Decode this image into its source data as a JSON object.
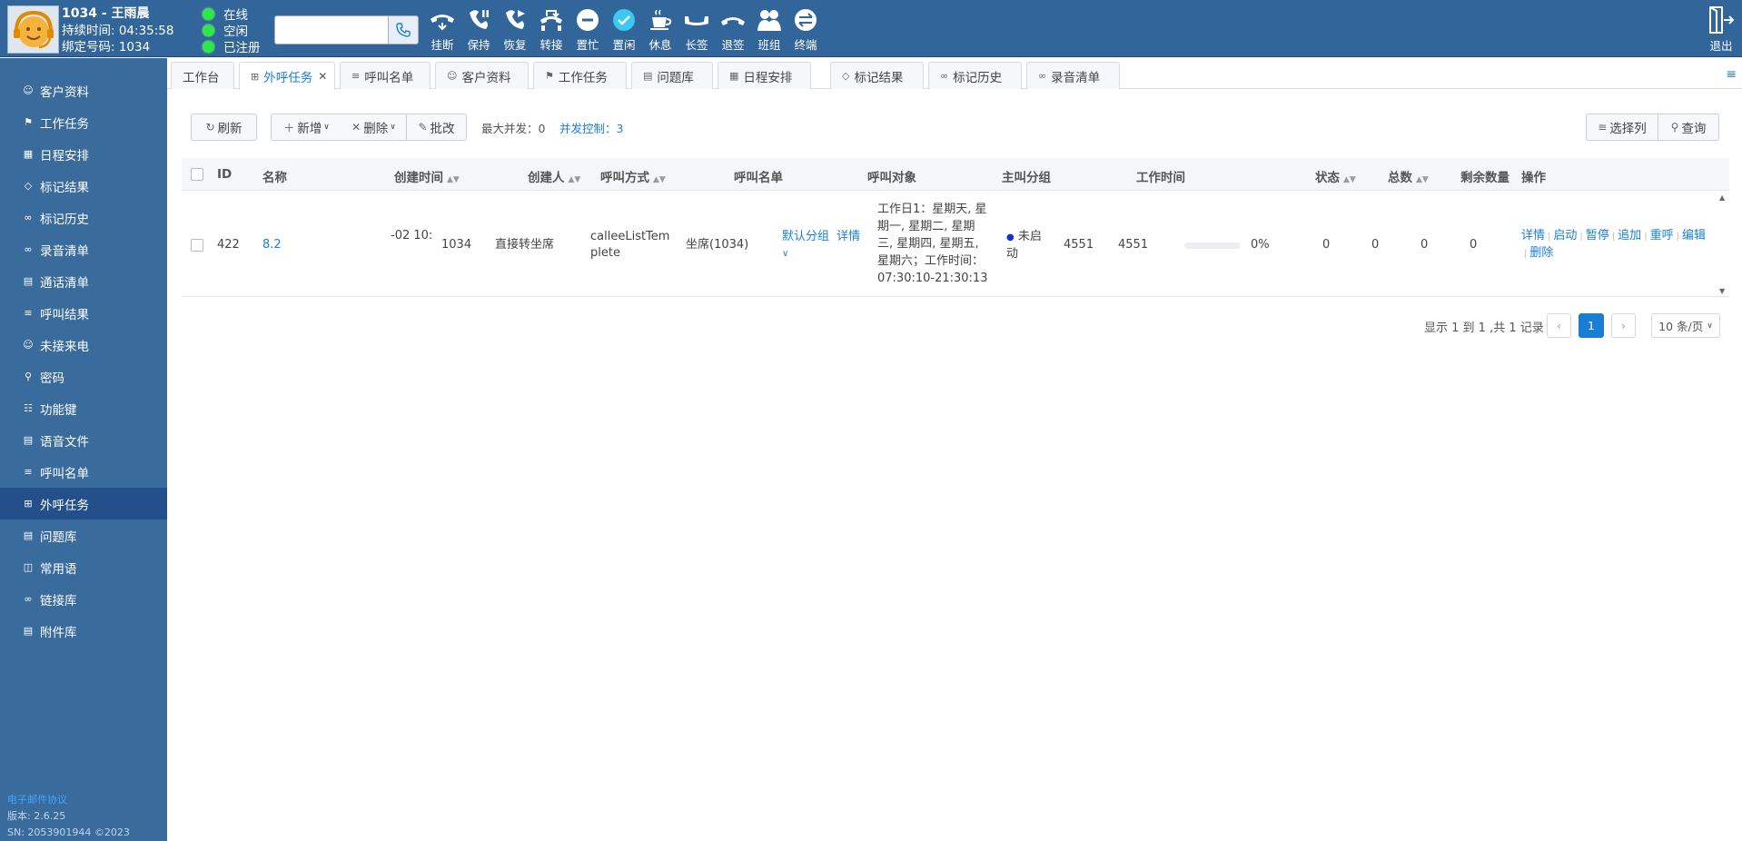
{
  "agent": {
    "title": "1034 - 王雨晨",
    "duration": "持续时间: 04:35:58",
    "binding": "绑定号码: 1034"
  },
  "status_list": [
    "在线",
    "空闲",
    "已注册"
  ],
  "dial": {
    "value": "",
    "placeholder": ""
  },
  "toolbar": [
    {
      "label": "挂断",
      "icon": "hangup-icon"
    },
    {
      "label": "保持",
      "icon": "hold-icon"
    },
    {
      "label": "恢复",
      "icon": "resume-icon"
    },
    {
      "label": "转接",
      "icon": "transfer-icon"
    },
    {
      "label": "置忙",
      "icon": "busy-icon"
    },
    {
      "label": "置闲",
      "icon": "idle-icon"
    },
    {
      "label": "休息",
      "icon": "coffee-icon"
    },
    {
      "label": "长签",
      "icon": "long-sign-icon"
    },
    {
      "label": "退签",
      "icon": "sign-out-icon"
    },
    {
      "label": "班组",
      "icon": "team-icon"
    },
    {
      "label": "终端",
      "icon": "terminal-icon"
    }
  ],
  "logout_label": "退出",
  "sidebar": {
    "items": [
      {
        "label": "客户资料",
        "icon": "user-icon"
      },
      {
        "label": "工作任务",
        "icon": "flag-icon"
      },
      {
        "label": "日程安排",
        "icon": "calendar-icon"
      },
      {
        "label": "标记结果",
        "icon": "tag-icon"
      },
      {
        "label": "标记历史",
        "icon": "link-icon"
      },
      {
        "label": "录音清单",
        "icon": "tape-icon"
      },
      {
        "label": "通话清单",
        "icon": "list-icon"
      },
      {
        "label": "呼叫结果",
        "icon": "filter-icon"
      },
      {
        "label": "未接来电",
        "icon": "user-icon"
      },
      {
        "label": "密码",
        "icon": "key-icon"
      },
      {
        "label": "功能键",
        "icon": "sitemap-icon"
      },
      {
        "label": "语音文件",
        "icon": "file-icon"
      },
      {
        "label": "呼叫名单",
        "icon": "bullet-list-icon"
      },
      {
        "label": "外呼任务",
        "icon": "grid-icon"
      },
      {
        "label": "问题库",
        "icon": "book-icon"
      },
      {
        "label": "常用语",
        "icon": "comment-icon"
      },
      {
        "label": "链接库",
        "icon": "link-icon"
      },
      {
        "label": "附件库",
        "icon": "attachment-icon"
      }
    ],
    "active_index": 13,
    "footer": {
      "link": "电子邮件协议",
      "version": "版本: 2.6.25",
      "sn": "SN: 2053901944    ©2023"
    }
  },
  "tabs": [
    {
      "label": "工作台",
      "icon": ""
    },
    {
      "label": "外呼任务",
      "icon": "grid-icon",
      "active": true,
      "closable": true
    },
    {
      "label": "呼叫名单",
      "icon": "bullet-list-icon"
    },
    {
      "label": "客户资料",
      "icon": "user-icon"
    },
    {
      "label": "工作任务",
      "icon": "flag-icon"
    },
    {
      "label": "问题库",
      "icon": "book-icon"
    },
    {
      "label": "日程安排",
      "icon": "calendar-icon"
    },
    {
      "label": "标记结果",
      "icon": "tag-icon"
    },
    {
      "label": "标记历史",
      "icon": "link-icon"
    },
    {
      "label": "录音清单",
      "icon": "tape-icon"
    }
  ],
  "actions": {
    "refresh": "刷新",
    "add": "新增",
    "delete": "删除",
    "batch_edit": "批改",
    "max_concurrency": "最大并发：0",
    "concurrency_control": "并发控制：3",
    "select_columns": "选择列",
    "query": "查询"
  },
  "table": {
    "headers": [
      "ID",
      "名称",
      "创建时间",
      "创建人",
      "呼叫方式",
      "呼叫名单",
      "呼叫对象",
      "主叫分组",
      "工作时间",
      "状态",
      "总数",
      "剩余数量",
      "操作"
    ],
    "rows": [
      {
        "id": "422",
        "name": "8.2",
        "created_time": "-02 10:",
        "creator": "1034",
        "call_mode": "直接转坐席",
        "call_list": "calleeListTemplete",
        "call_target": "坐席(1034)",
        "caller_group": "默认分组",
        "caller_group_detail": "详情",
        "work_time": "工作日1：星期天, 星期一, 星期二, 星期三, 星期四, 星期五, 星期六；工作时间：07:30:10-21:30:13",
        "status": "未启动",
        "n1": "4551",
        "n2": "4551",
        "progress_label": "0%",
        "progress": 0,
        "n3": "0",
        "n4": "0",
        "n5": "0",
        "n6": "0",
        "ops": [
          "详情",
          "启动",
          "暂停",
          "追加",
          "重呼",
          "编辑",
          "删除"
        ]
      }
    ]
  },
  "pagination": {
    "info": "显示 1 到 1 ,共 1 记录",
    "prev": "‹",
    "current": "1",
    "next": "›",
    "page_size": "10 条/页"
  },
  "colors": {
    "topbar": "#32669b",
    "sidebar": "#3a6b9d",
    "accent": "#1a7fd4",
    "online": "#2ee84a"
  }
}
